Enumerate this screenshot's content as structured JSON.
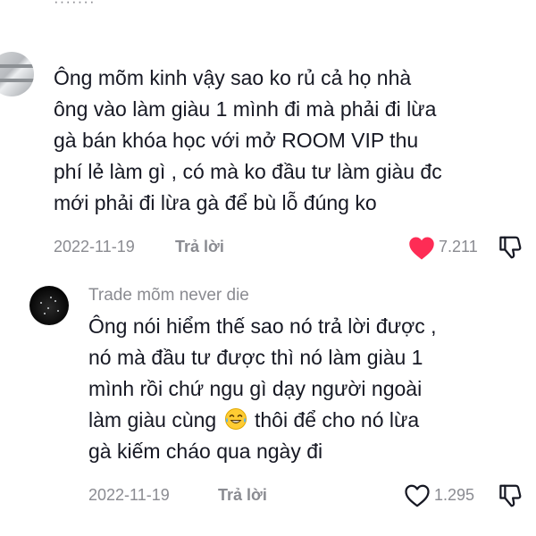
{
  "comment1": {
    "author": "·······",
    "lines": [
      "Ông mõm kinh vậy sao ko rủ cả họ nhà",
      "ông vào làm giàu 1 mình đi mà phải đi lừa",
      "gà bán khóa học với mở ROOM VIP thu",
      "phí lẻ làm gì , có mà ko đầu tư làm giàu đc",
      "mới phải đi lừa gà để bù lỗ đúng ko"
    ],
    "date": "2022-11-19",
    "reply_label": "Trả lời",
    "likes": "7.211",
    "liked": true,
    "like_color": "#fe2c55"
  },
  "comment2": {
    "author": "Trade mõm never die",
    "lines": [
      "Ông nói hiểm thế sao nó trả lời được ,",
      "nó mà đầu tư được thì nó làm giàu 1",
      "mình rồi chứ ngu gì dạy người ngoài"
    ],
    "line4_before_emoji": "làm giàu cùng",
    "line4_after_emoji": " thôi để cho nó lừa",
    "line5": "gà kiếm cháo qua ngày đi",
    "emoji": "laughing-with-tears",
    "date": "2022-11-19",
    "reply_label": "Trả lời",
    "likes": "1.295",
    "liked": false
  }
}
